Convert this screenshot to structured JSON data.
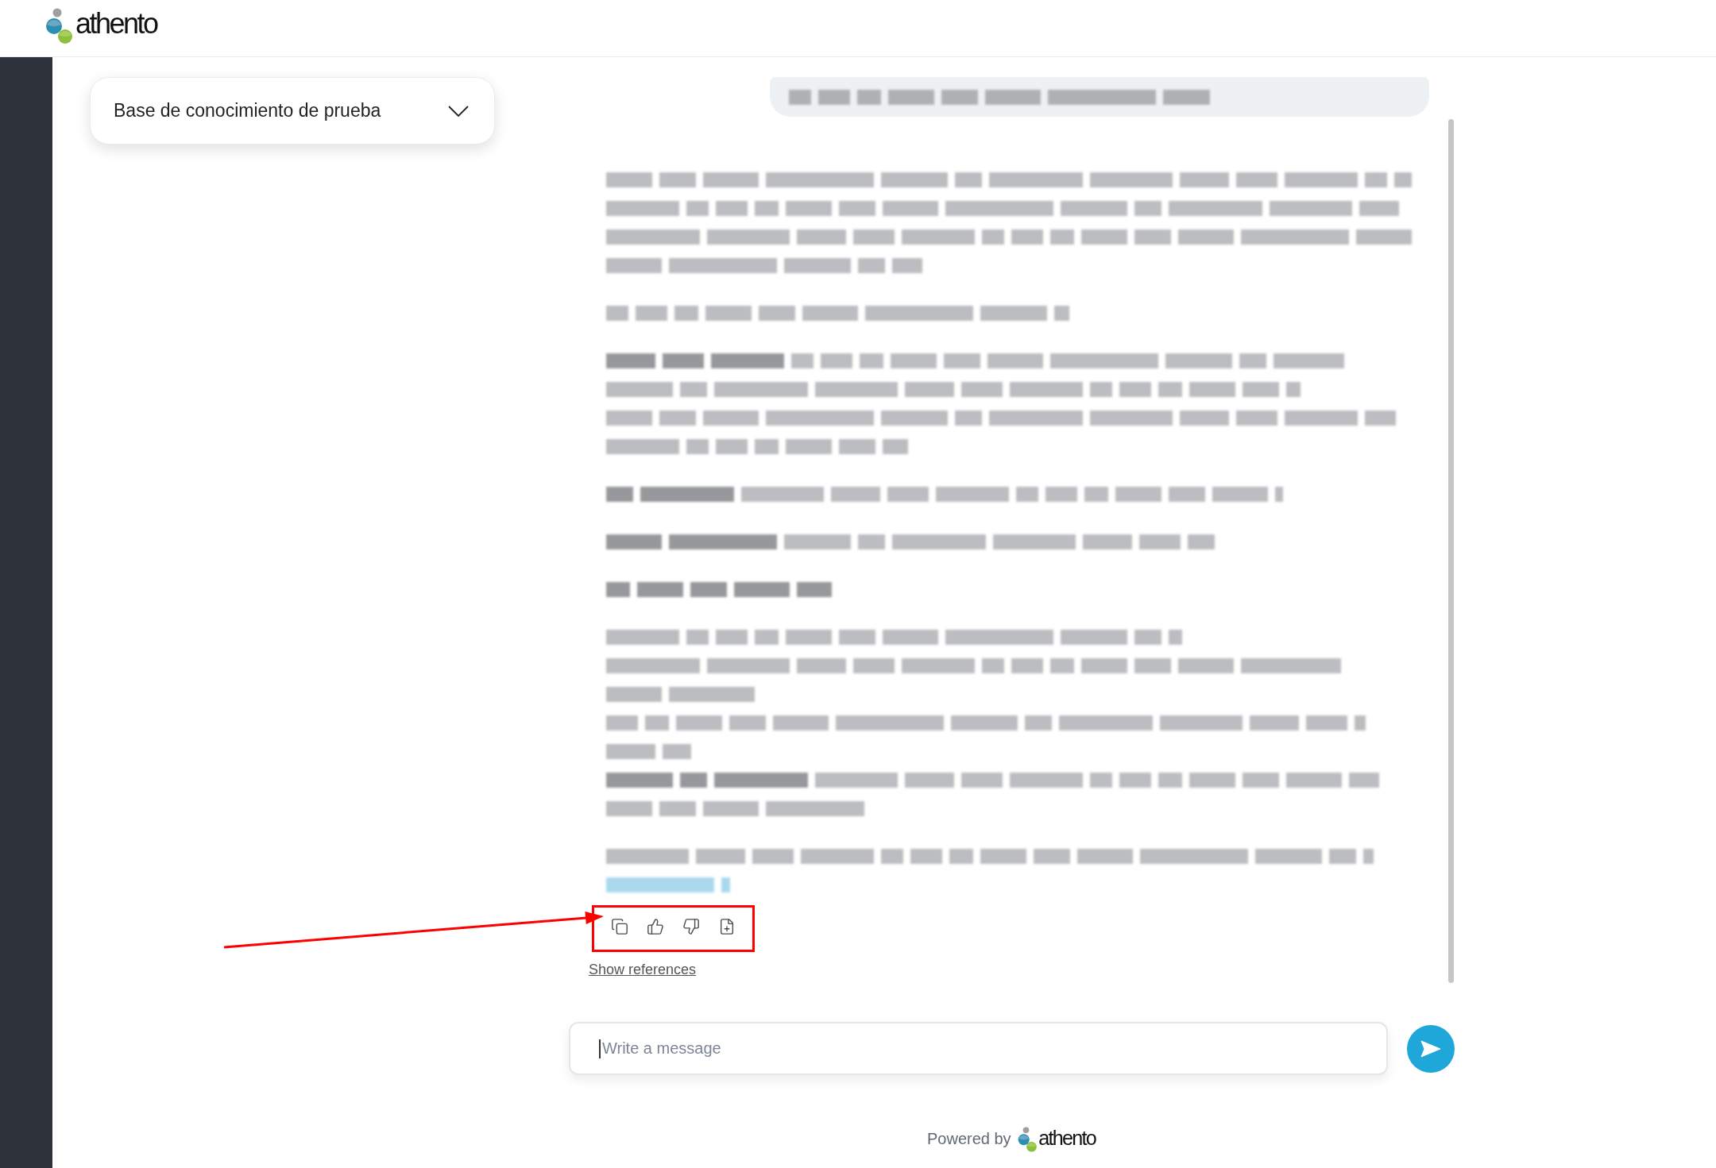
{
  "header": {
    "logo_text": "athento"
  },
  "knowledge_base_select": {
    "value": "Base de conocimiento de prueba",
    "expanded": false
  },
  "messages": [
    {
      "kind": "question"
    },
    {
      "kind": "answer"
    }
  ],
  "answer_actions": [
    {
      "kind": "copy"
    },
    {
      "kind": "like"
    },
    {
      "kind": "dislike"
    },
    {
      "kind": "add-document"
    }
  ],
  "annotation": {
    "kind": "arrow-to-box"
  },
  "references_link": "Show references",
  "composer": {
    "placeholder": "Write a message",
    "focused": true
  },
  "footer": {
    "powered_by": "Powered by",
    "logo_text": "athento"
  }
}
